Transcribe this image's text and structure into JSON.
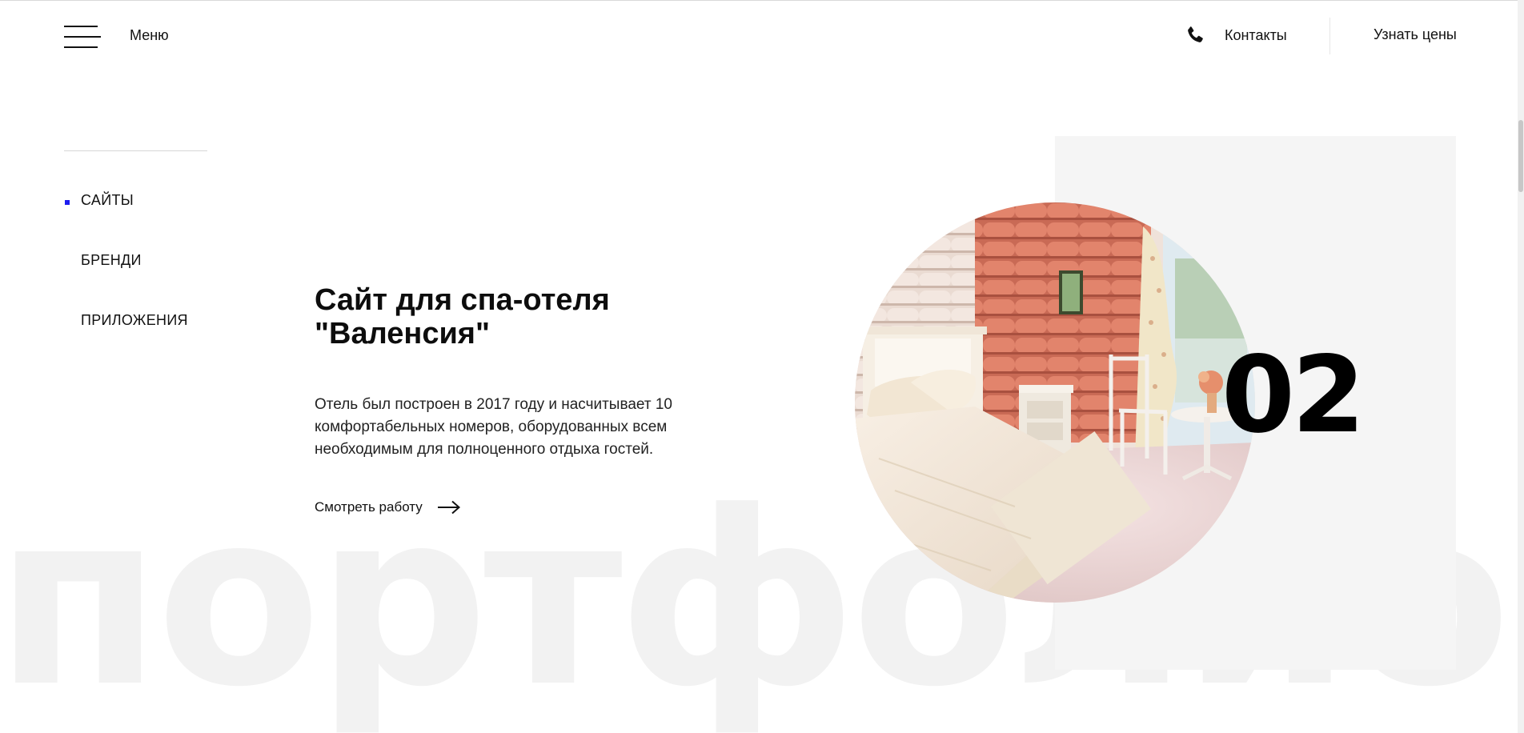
{
  "header": {
    "menu_label": "Меню",
    "contacts_label": "Контакты",
    "prices_label": "Узнать цены"
  },
  "categories": [
    {
      "label": "САЙТЫ",
      "active": true
    },
    {
      "label": "БРЕНДИ",
      "active": false
    },
    {
      "label": "ПРИЛОЖЕНИЯ",
      "active": false
    }
  ],
  "project": {
    "title": "Сайт для спа-отеля \"Валенсия\"",
    "description": "Отель был построен в 2017 году и насчитывает 10 комфортабельных номеров, оборудованных всем необходимым для полноценного отдыха гостей.",
    "view_label": "Смотреть работу",
    "number": "02"
  },
  "background_word": "портфолио",
  "colors": {
    "accent": "#1d1df0",
    "text": "#111111",
    "panel": "#f5f5f5",
    "background_word": "#f2f2f2"
  },
  "icons": {
    "menu": "hamburger-icon",
    "contacts": "phone-icon",
    "view": "arrow-right-icon"
  }
}
